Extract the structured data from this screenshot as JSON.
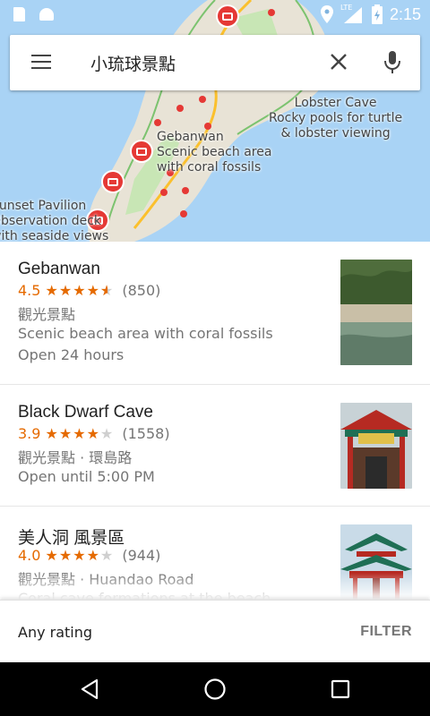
{
  "status_bar": {
    "time": "2:15",
    "network": "LTE",
    "icons": [
      "sd-card-icon",
      "android-icon",
      "location-icon",
      "signal-icon",
      "battery-charging-icon"
    ]
  },
  "search": {
    "menu_icon": "menu-icon",
    "query": "小琉球景點",
    "clear_icon": "close-icon",
    "voice_icon": "mic-icon"
  },
  "map": {
    "colors": {
      "water": "#a9d3f5",
      "land": "#e8e3d6",
      "park": "#c8e6b5",
      "road": "#fbc02d",
      "marker": "#e53935"
    },
    "labels": [
      {
        "id": "lobster",
        "title": "Lobster Cave",
        "lines": [
          "Rocky pools for turtle",
          "& lobster viewing"
        ]
      },
      {
        "id": "gebanwan",
        "title": "Gebanwan",
        "lines": [
          "Scenic beach area",
          "with coral fossils"
        ]
      },
      {
        "id": "sunset",
        "title": "Sunset Pavilion",
        "lines": [
          "Observation deck",
          "with seaside views"
        ]
      }
    ]
  },
  "results": [
    {
      "title": "Gebanwan",
      "rating": "4.5",
      "stars": 4.5,
      "reviews": "(850)",
      "category": "觀光景點",
      "description": "Scenic beach area with coral fossils",
      "hours": "Open 24 hours"
    },
    {
      "title": "Black Dwarf Cave",
      "rating": "3.9",
      "stars": 4,
      "reviews": "(1558)",
      "category": "觀光景點 · 環島路",
      "hours": "Open until 5:00 PM"
    },
    {
      "title": "美人洞 風景區",
      "rating": "4.0",
      "stars": 4,
      "reviews": "(944)",
      "category": "觀光景點 · Huandao Road",
      "description": "Coral cave formations at the beach"
    }
  ],
  "footer": {
    "rating_filter": "Any rating",
    "filter_label": "FILTER"
  },
  "nav_bar": {
    "icons": [
      "back-icon",
      "home-icon",
      "recents-icon"
    ]
  }
}
